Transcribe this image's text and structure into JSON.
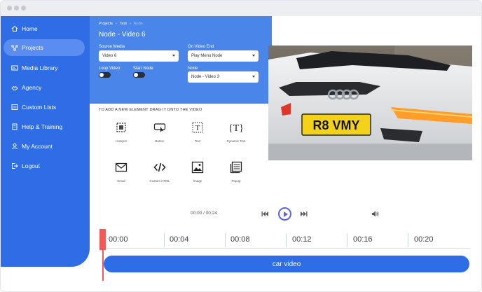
{
  "sidebar": {
    "items": [
      {
        "label": "Home",
        "icon": "home-icon"
      },
      {
        "label": "Projects",
        "icon": "projects-icon",
        "active": true
      },
      {
        "label": "Media Library",
        "icon": "media-library-icon"
      },
      {
        "label": "Agency",
        "icon": "agency-icon"
      },
      {
        "label": "Custom Lists",
        "icon": "custom-lists-icon"
      },
      {
        "label": "Help & Training",
        "icon": "help-icon"
      },
      {
        "label": "My Account",
        "icon": "account-icon"
      },
      {
        "label": "Logout",
        "icon": "logout-icon"
      }
    ]
  },
  "header": {
    "breadcrumb": [
      "Projects",
      "Test",
      "Node"
    ],
    "title": "Node - Video 6",
    "source_media": {
      "label": "Source Media",
      "value": "Video 6"
    },
    "on_video_end": {
      "label": "On Video End",
      "value": "Play Menu Node"
    },
    "loop_video": {
      "label": "Loop Video",
      "on": false
    },
    "start_node": {
      "label": "Start Node",
      "on": false
    },
    "node": {
      "label": "Node",
      "value": "Node - Video 3"
    }
  },
  "video": {
    "plate": "R8 VMY"
  },
  "elements": {
    "heading": "TO ADD A NEW ELEMENT DRAG IT ONTO THE VIDEO",
    "items": [
      "Hotspot",
      "Button",
      "Text",
      "Dynamic Text",
      "Email",
      "Custom HTML",
      "Image",
      "Popup"
    ]
  },
  "player": {
    "time": "00:00 / 00:24"
  },
  "timeline": {
    "labels": [
      "00:00",
      "00:04",
      "00:08",
      "00:12",
      "00:16",
      "00:20"
    ],
    "clip_label": "car video"
  },
  "colors": {
    "primary": "#2f6de6",
    "panel": "#4a86ea",
    "playhead": "#ef5a5a",
    "play": "#5b63e8"
  }
}
